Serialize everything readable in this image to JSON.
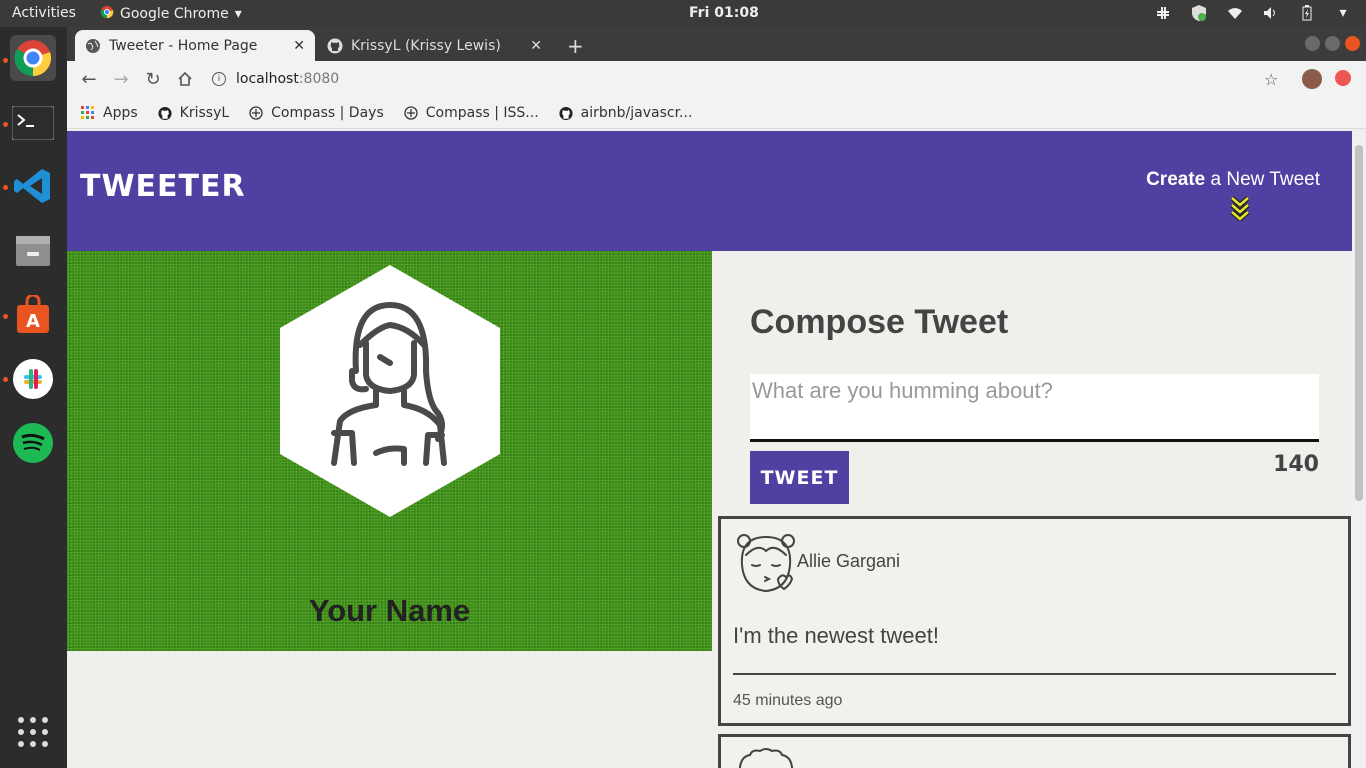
{
  "system": {
    "activities": "Activities",
    "app_name": "Google Chrome",
    "clock": "Fri 01:08"
  },
  "browser": {
    "tabs": [
      {
        "title": "Tweeter - Home Page",
        "active": true
      },
      {
        "title": "KrissyL (Krissy Lewis)",
        "active": false
      }
    ],
    "url_host": "localhost",
    "url_port": ":8080",
    "bookmarks": [
      {
        "label": "Apps",
        "icon": "apps-grid-icon"
      },
      {
        "label": "KrissyL",
        "icon": "github-icon"
      },
      {
        "label": "Compass | Days",
        "icon": "compass-icon"
      },
      {
        "label": "Compass | ISS...",
        "icon": "compass-icon"
      },
      {
        "label": "airbnb/javascr...",
        "icon": "github-icon"
      }
    ]
  },
  "header": {
    "brand": "TWEETER",
    "create_bold": "Create",
    "create_rest": " a New Tweet",
    "accent_color": "#4f40a1",
    "chevron_color": "#e5e52a"
  },
  "profile": {
    "name": "Your Name"
  },
  "compose": {
    "title": "Compose Tweet",
    "placeholder": "What are you humming about?",
    "button": "TWEET",
    "counter": "140"
  },
  "tweets": [
    {
      "author": "Allie Gargani",
      "content": "I'm the newest tweet!",
      "time": "45 minutes ago"
    }
  ]
}
